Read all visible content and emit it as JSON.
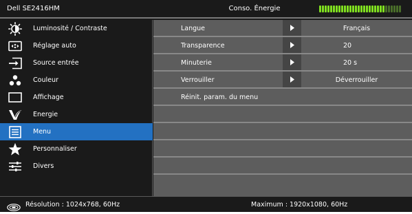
{
  "header": {
    "model": "Dell SE2416HM",
    "title": "Conso. Énergie",
    "energy_level": 0.8,
    "colors": {
      "meter_on": "#80e020",
      "meter_off": "#4a6e2a"
    }
  },
  "left_menu": {
    "items": [
      {
        "label": "Luminosité / Contraste",
        "icon": "brightness-icon"
      },
      {
        "label": "Réglage auto",
        "icon": "auto-adjust-icon"
      },
      {
        "label": "Source entrée",
        "icon": "input-source-icon"
      },
      {
        "label": "Couleur",
        "icon": "color-icon"
      },
      {
        "label": "Affichage",
        "icon": "display-icon"
      },
      {
        "label": "Energie",
        "icon": "energy-icon"
      },
      {
        "label": "Menu",
        "icon": "menu-icon",
        "selected": true
      },
      {
        "label": "Personnaliser",
        "icon": "star-icon"
      },
      {
        "label": "Divers",
        "icon": "others-icon"
      }
    ],
    "active_color": "#2371c2"
  },
  "submenu": {
    "rows": [
      {
        "label": "Langue",
        "value": "Français",
        "arrow": "right-arrow-icon"
      },
      {
        "label": "Transparence",
        "value": "20",
        "arrow": "right-arrow-icon"
      },
      {
        "label": "Minuterie",
        "value": "20 s",
        "arrow": "right-arrow-icon"
      },
      {
        "label": "Verrouiller",
        "value": "Déverrouiller",
        "arrow": "right-arrow-icon"
      },
      {
        "label": "Réinit. param. du menu"
      }
    ]
  },
  "footer": {
    "resolution_icon": "resolution-icon",
    "resolution": "Résolution  : 1024x768, 60Hz",
    "maximum": "Maximum  : 1920x1080, 60Hz"
  }
}
